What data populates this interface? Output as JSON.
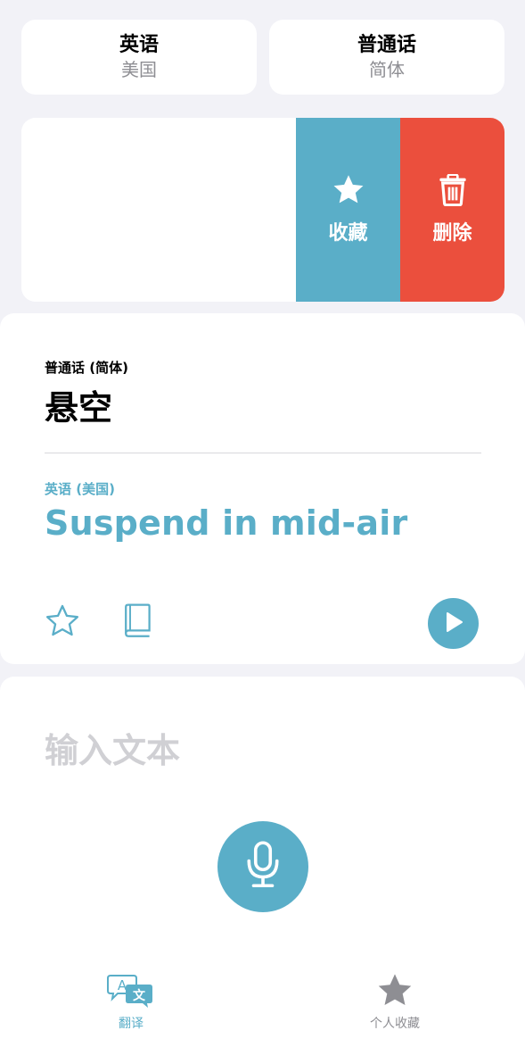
{
  "languages": {
    "source": {
      "name": "英语",
      "region": "美国"
    },
    "target": {
      "name": "普通话",
      "region": "简体"
    }
  },
  "swipe_actions": {
    "favorite_label": "收藏",
    "delete_label": "删除"
  },
  "translation": {
    "source_lang_label": "普通话 (简体)",
    "source_text": "悬空",
    "target_lang_label": "英语 (美国)",
    "target_text": "Suspend in mid-air"
  },
  "input": {
    "placeholder": "输入文本"
  },
  "tab_bar": {
    "items": [
      {
        "label": "翻译",
        "icon": "translate-icon",
        "active": true
      },
      {
        "label": "个人收藏",
        "icon": "star-icon",
        "active": false
      }
    ]
  },
  "colors": {
    "accent": "#5aaec8",
    "delete": "#eb4f3d",
    "background": "#f2f2f7",
    "inactive": "#8e8e93"
  }
}
